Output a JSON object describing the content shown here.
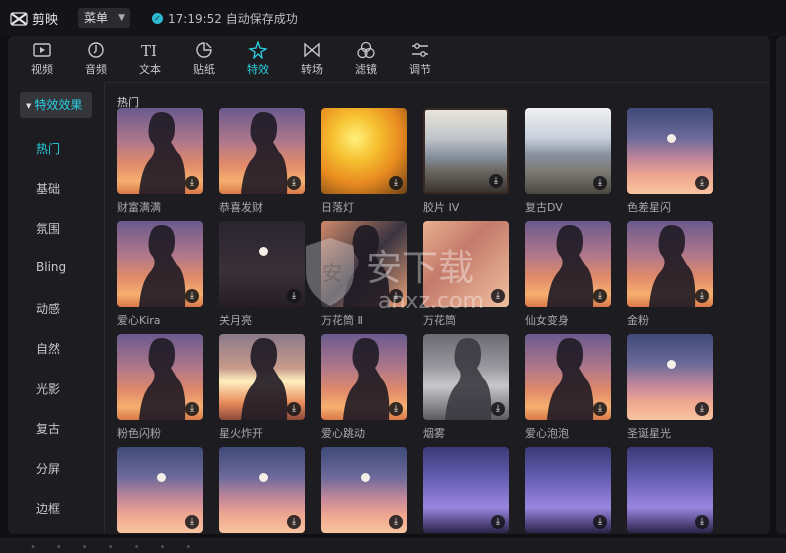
{
  "app": {
    "name": "剪映",
    "menu_label": "菜单",
    "save_status": "17:19:52 自动保存成功"
  },
  "tabs": [
    {
      "label": "视频",
      "icon": "video-icon"
    },
    {
      "label": "音频",
      "icon": "audio-icon"
    },
    {
      "label": "文本",
      "icon": "text-icon"
    },
    {
      "label": "贴纸",
      "icon": "sticker-icon"
    },
    {
      "label": "特效",
      "icon": "effects-icon",
      "active": true
    },
    {
      "label": "转场",
      "icon": "transition-icon"
    },
    {
      "label": "滤镜",
      "icon": "filter-icon"
    },
    {
      "label": "调节",
      "icon": "adjust-icon"
    }
  ],
  "sidebar": {
    "header": "特效效果",
    "items": [
      {
        "label": "热门",
        "active": true
      },
      {
        "label": "基础"
      },
      {
        "label": "氛围"
      },
      {
        "label": "Bling"
      },
      {
        "label": "动感"
      },
      {
        "label": "自然"
      },
      {
        "label": "光影"
      },
      {
        "label": "复古"
      },
      {
        "label": "分屏"
      },
      {
        "label": "边框"
      }
    ]
  },
  "section_title": "热门",
  "effects": [
    {
      "name": "财富满满",
      "theme": "sunset"
    },
    {
      "name": "恭喜发财",
      "theme": "sunset"
    },
    {
      "name": "日落灯",
      "theme": "yellow"
    },
    {
      "name": "胶片 IV",
      "theme": "retro"
    },
    {
      "name": "复古DV",
      "theme": "retro2"
    },
    {
      "name": "色差星闪",
      "theme": "sky"
    },
    {
      "name": "爱心Kira",
      "theme": "sunset"
    },
    {
      "name": "关月亮",
      "theme": "dark"
    },
    {
      "name": "万花筒 Ⅱ",
      "theme": "kaleido"
    },
    {
      "name": "万花筒",
      "theme": "kaleido2"
    },
    {
      "name": "仙女变身",
      "theme": "sunset"
    },
    {
      "name": "金粉",
      "theme": "sunset"
    },
    {
      "name": "粉色闪粉",
      "theme": "sunset"
    },
    {
      "name": "星火炸开",
      "theme": "spark"
    },
    {
      "name": "爱心跳动",
      "theme": "sunset"
    },
    {
      "name": "烟雾",
      "theme": "smoke"
    },
    {
      "name": "爱心泡泡",
      "theme": "sunset"
    },
    {
      "name": "圣诞星光",
      "theme": "sky"
    },
    {
      "name": "",
      "theme": "sky"
    },
    {
      "name": "",
      "theme": "sky"
    },
    {
      "name": "",
      "theme": "sky"
    },
    {
      "name": "",
      "theme": "purple"
    },
    {
      "name": "",
      "theme": "purple"
    },
    {
      "name": "",
      "theme": "purple"
    }
  ],
  "watermark": {
    "text": "安下载",
    "sub": "anxz.com"
  }
}
